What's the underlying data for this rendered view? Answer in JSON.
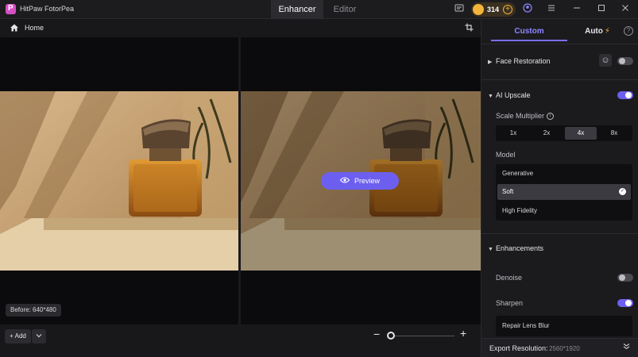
{
  "app": {
    "title": "HitPaw FotorPea"
  },
  "top_tabs": [
    {
      "label": "Enhancer",
      "active": true
    },
    {
      "label": "Editor",
      "active": false
    }
  ],
  "titlebar": {
    "credits": "314",
    "icons": [
      "feedback-icon",
      "coin-icon",
      "add-credits-icon",
      "account-icon",
      "menu-icon",
      "minimize-icon",
      "maximize-icon",
      "close-icon"
    ]
  },
  "breadcrumb": {
    "home": "Home"
  },
  "canvas": {
    "preview_label": "Preview",
    "before_label": "Before: 640*480"
  },
  "bottombar": {
    "add_label": "+ Add"
  },
  "panel": {
    "tabs": [
      {
        "label": "Custom",
        "active": true
      },
      {
        "label": "Auto",
        "active": false
      }
    ],
    "face_restoration": {
      "label": "Face Restoration",
      "enabled": false
    },
    "ai_upscale": {
      "label": "AI Upscale",
      "enabled": true,
      "scale_label": "Scale Multiplier",
      "scale_options": [
        "1x",
        "2x",
        "4x",
        "8x"
      ],
      "scale_selected": "4x",
      "model_label": "Model",
      "models": [
        "Generative",
        "Soft",
        "High Fidelity"
      ],
      "model_selected": "Soft"
    },
    "enhancements": {
      "label": "Enhancements",
      "denoise": {
        "label": "Denoise",
        "enabled": false
      },
      "sharpen": {
        "label": "Sharpen",
        "enabled": true
      },
      "repair": "Repair Lens Blur"
    },
    "export": {
      "label": "Export Resolution:",
      "value": "2560*1920"
    }
  },
  "colors": {
    "accent": "#6c5ff0",
    "coin": "#f3b43a"
  }
}
